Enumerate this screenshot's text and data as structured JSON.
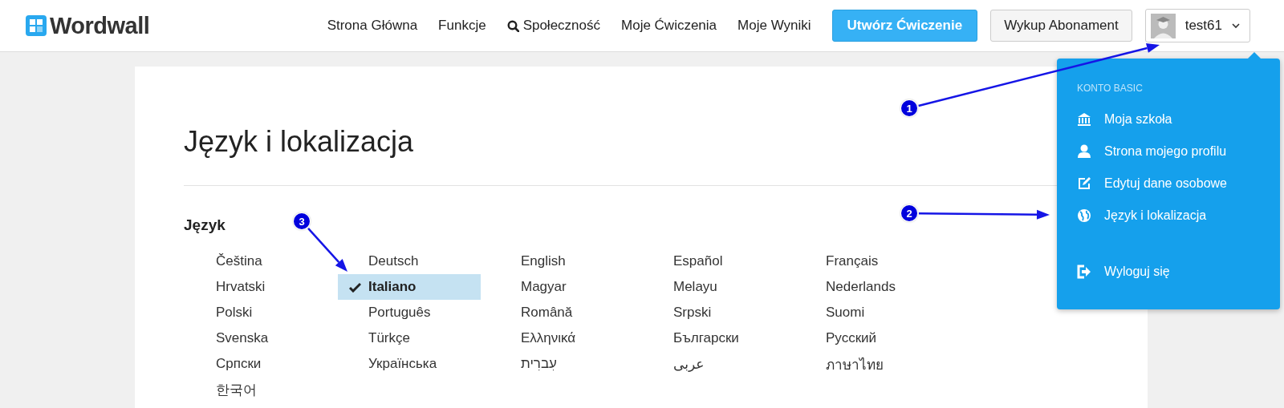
{
  "header": {
    "logo": "Wordwall",
    "nav": [
      {
        "label": "Strona Główna",
        "kind": "plain"
      },
      {
        "label": "Funkcje",
        "kind": "plain"
      },
      {
        "label": "Społeczność",
        "kind": "search"
      },
      {
        "label": "Moje Ćwiczenia",
        "kind": "plain"
      },
      {
        "label": "Moje Wyniki",
        "kind": "plain"
      }
    ],
    "create_button": "Utwórz Ćwiczenie",
    "subscribe_button": "Wykup Abonament",
    "user": "test61"
  },
  "dropdown": {
    "heading": "KONTO BASIC",
    "items": [
      {
        "label": "Moja szkoła",
        "kind": "school"
      },
      {
        "label": "Strona mojego profilu",
        "kind": "profile"
      },
      {
        "label": "Edytuj dane osobowe",
        "kind": "edit"
      },
      {
        "label": "Język i lokalizacja",
        "kind": "globe"
      },
      {
        "label": "Wyloguj się",
        "kind": "logout"
      }
    ]
  },
  "page": {
    "title": "Język i lokalizacja",
    "section": "Język",
    "languages": [
      {
        "label": "Čeština",
        "selected": false
      },
      {
        "label": "Deutsch",
        "selected": false
      },
      {
        "label": "English",
        "selected": false
      },
      {
        "label": "Español",
        "selected": false
      },
      {
        "label": "Français",
        "selected": false
      },
      {
        "label": "Hrvatski",
        "selected": false
      },
      {
        "label": "Italiano",
        "selected": true
      },
      {
        "label": "Magyar",
        "selected": false
      },
      {
        "label": "Melayu",
        "selected": false
      },
      {
        "label": "Nederlands",
        "selected": false
      },
      {
        "label": "Polski",
        "selected": false
      },
      {
        "label": "Português",
        "selected": false
      },
      {
        "label": "Română",
        "selected": false
      },
      {
        "label": "Srpski",
        "selected": false
      },
      {
        "label": "Suomi",
        "selected": false
      },
      {
        "label": "Svenska",
        "selected": false
      },
      {
        "label": "Türkçe",
        "selected": false
      },
      {
        "label": "Ελληνικά",
        "selected": false
      },
      {
        "label": "Български",
        "selected": false
      },
      {
        "label": "Русский",
        "selected": false
      },
      {
        "label": "Српски",
        "selected": false
      },
      {
        "label": "Українська",
        "selected": false
      },
      {
        "label": "עִברִית",
        "selected": false
      },
      {
        "label": "عربى",
        "selected": false
      },
      {
        "label": "ภาษาไทย",
        "selected": false
      },
      {
        "label": "한국어",
        "selected": false
      }
    ]
  },
  "annotations": [
    {
      "number": "1"
    },
    {
      "number": "2"
    },
    {
      "number": "3"
    }
  ]
}
